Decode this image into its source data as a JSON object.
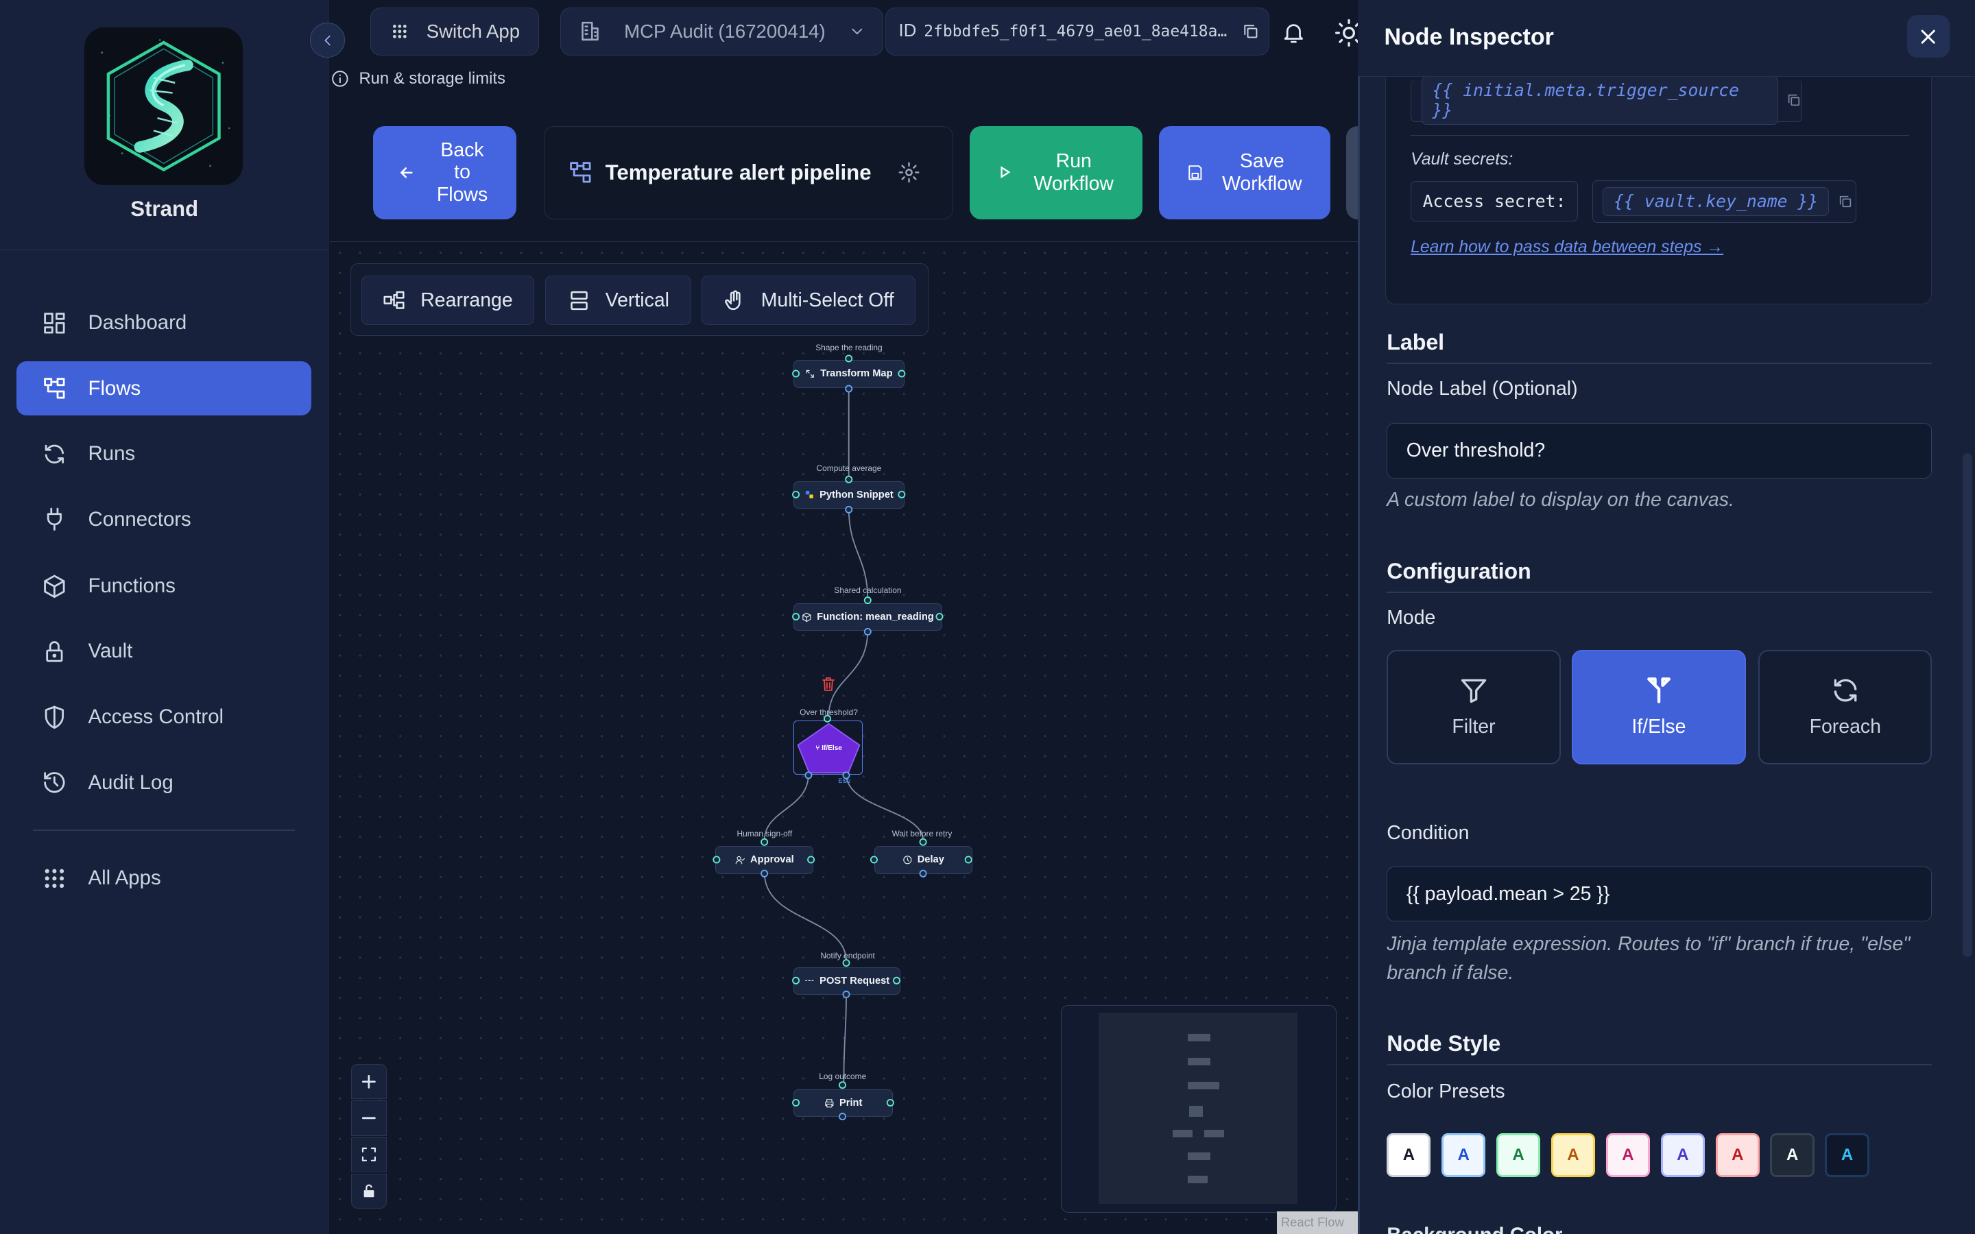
{
  "app": {
    "brand": "Strand"
  },
  "sidebar": {
    "items": [
      {
        "label": "Dashboard",
        "icon": "dashboard-icon"
      },
      {
        "label": "Flows",
        "icon": "flows-icon",
        "active": true
      },
      {
        "label": "Runs",
        "icon": "runs-icon"
      },
      {
        "label": "Connectors",
        "icon": "plug-icon"
      },
      {
        "label": "Functions",
        "icon": "cube-icon"
      },
      {
        "label": "Vault",
        "icon": "lock-icon"
      },
      {
        "label": "Access Control",
        "icon": "shield-icon"
      },
      {
        "label": "Audit Log",
        "icon": "history-icon"
      }
    ],
    "all_apps": "All Apps"
  },
  "topbar": {
    "switch_app": "Switch App",
    "org": "MCP Audit (167200414)",
    "id_prefix": "ID",
    "id_value": "2fbbdfe5_f0f1_4679_ae01_8ae418a…",
    "limits": "Run & storage limits"
  },
  "header": {
    "back": "Back to Flows",
    "flow_name": "Temperature alert pipeline",
    "run": "Run Workflow",
    "save": "Save Workflow"
  },
  "canvas": {
    "tools": {
      "rearrange": "Rearrange",
      "vertical": "Vertical",
      "multiselect": "Multi-Select Off"
    },
    "nodes": [
      {
        "label": "Shape the reading",
        "title": "Transform Map"
      },
      {
        "label": "Compute average",
        "title": "Python Snippet"
      },
      {
        "label": "Shared calculation",
        "title": "Function: mean_reading"
      },
      {
        "label": "Over threshold?",
        "title": "If/Else",
        "else_handle": "Else"
      },
      {
        "label": "Human sign-off",
        "title": "Approval"
      },
      {
        "label": "Wait before retry",
        "title": "Delay"
      },
      {
        "label": "Notify endpoint",
        "title": "POST Request"
      },
      {
        "label": "Log outcome",
        "title": "Print"
      }
    ],
    "attribution": "React Flow"
  },
  "inspector": {
    "title": "Node Inspector",
    "trigger_code": "{{ initial.meta.trigger_source }}",
    "vault_label": "Vault secrets:",
    "access_secret": "Access secret:",
    "vault_code": "{{ vault.key_name }}",
    "learn_link": "Learn how to pass data between steps →",
    "label_section": "Label",
    "node_label_title": "Node Label (Optional)",
    "node_label_value": "Over threshold?",
    "node_label_help": "A custom label to display on the canvas.",
    "config_section": "Configuration",
    "mode_label": "Mode",
    "modes": [
      {
        "label": "Filter",
        "icon": "filter-icon"
      },
      {
        "label": "If/Else",
        "icon": "split-icon",
        "active": true
      },
      {
        "label": "Foreach",
        "icon": "loop-icon"
      }
    ],
    "condition_label": "Condition",
    "condition_value": "{{ payload.mean > 25 }}",
    "condition_help": "Jinja template expression. Routes to \"if\" branch if true, \"else\" branch if false.",
    "style_section": "Node Style",
    "presets_label": "Color Presets",
    "swatch_letter": "A",
    "swatches": [
      {
        "bg": "#ffffff",
        "fg": "#111827",
        "border": "#d1d5db"
      },
      {
        "bg": "#eff6ff",
        "fg": "#1d4ed8",
        "border": "#93c5fd"
      },
      {
        "bg": "#ecfdf5",
        "fg": "#15803d",
        "border": "#86efac"
      },
      {
        "bg": "#fef3c7",
        "fg": "#b45309",
        "border": "#fcd34d"
      },
      {
        "bg": "#fdf2f8",
        "fg": "#be185d",
        "border": "#f9a8d4"
      },
      {
        "bg": "#eef2ff",
        "fg": "#4338ca",
        "border": "#a5b4fc"
      },
      {
        "bg": "#fee2e2",
        "fg": "#b91c1c",
        "border": "#fca5a5"
      },
      {
        "bg": "#1f2937",
        "fg": "#f9fafb",
        "border": "#374151"
      },
      {
        "bg": "#0f172a",
        "fg": "#38bdf8",
        "border": "#1e3a5f"
      }
    ],
    "bg_color_label": "Background Color"
  }
}
